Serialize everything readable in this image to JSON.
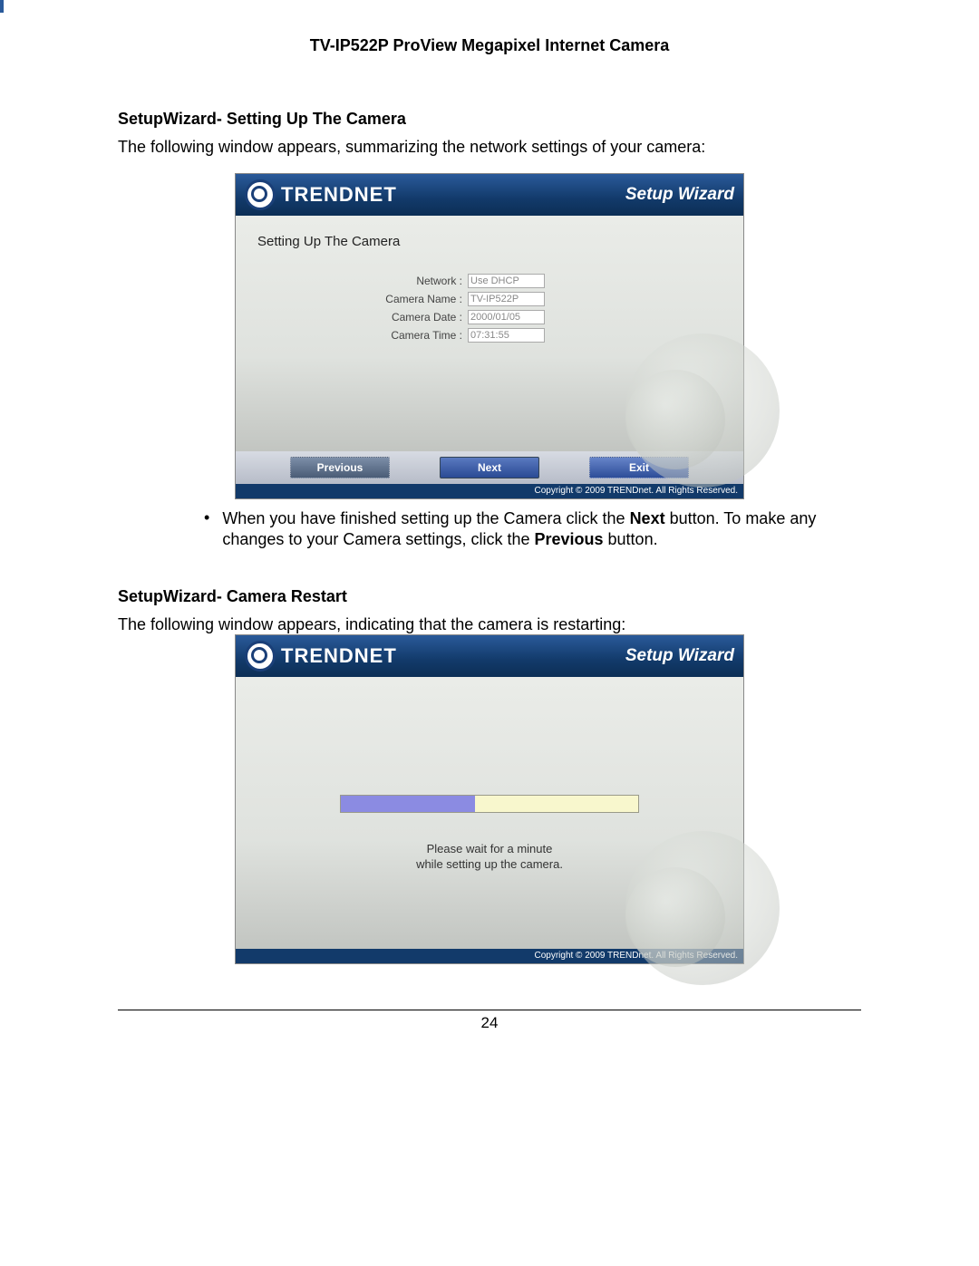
{
  "doc_title": "TV-IP522P ProView Megapixel Internet Camera",
  "sectionA": {
    "heading": "SetupWizard- Setting Up The Camera",
    "intro": "The following window appears, summarizing the network settings of your camera:"
  },
  "wizard1": {
    "brand": "TRENDNET",
    "label": "Setup Wizard",
    "panel_title": "Setting Up The Camera",
    "fields": {
      "network_label": "Network :",
      "network_value": "Use DHCP",
      "camera_name_label": "Camera Name :",
      "camera_name_value": "TV-IP522P",
      "camera_date_label": "Camera Date :",
      "camera_date_value": "2000/01/05",
      "camera_time_label": "Camera Time :",
      "camera_time_value": "07:31:55"
    },
    "buttons": {
      "previous": "Previous",
      "next": "Next",
      "exit": "Exit"
    },
    "copyright": "Copyright © 2009 TRENDnet. All Rights Reserved."
  },
  "bulletA": {
    "t1": "When you have finished setting up the Camera click the ",
    "b1": "Next",
    "t2": " button. To make any changes to your Camera settings, click the ",
    "b2": "Previous",
    "t3": " button."
  },
  "sectionB": {
    "heading": "SetupWizard- Camera Restart",
    "intro": "The following window appears, indicating that the camera is restarting:"
  },
  "wizard2": {
    "brand": "TRENDNET",
    "label": "Setup Wizard",
    "progress_line1": "Please wait for a minute",
    "progress_line2": "while setting up the camera.",
    "copyright": "Copyright © 2009 TRENDnet. All Rights Reserved."
  },
  "page_number": "24"
}
